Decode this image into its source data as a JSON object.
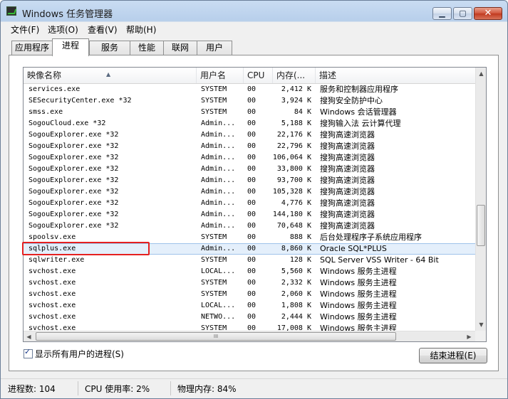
{
  "window": {
    "title": "Windows 任务管理器"
  },
  "titlebar_buttons": {
    "minimize": "▁",
    "maximize": "▢",
    "close": "✕"
  },
  "menu": [
    "文件(F)",
    "选项(O)",
    "查看(V)",
    "帮助(H)"
  ],
  "tabs": [
    {
      "label": "应用程序",
      "active": false
    },
    {
      "label": "进程",
      "active": true
    },
    {
      "label": "服务",
      "active": false
    },
    {
      "label": "性能",
      "active": false
    },
    {
      "label": "联网",
      "active": false
    },
    {
      "label": "用户",
      "active": false
    }
  ],
  "columns": {
    "name": "映像名称",
    "user": "用户名",
    "cpu": "CPU",
    "mem": "内存(...",
    "desc": "描述"
  },
  "processes": [
    {
      "name": "services.exe",
      "user": "SYSTEM",
      "cpu": "00",
      "mem": "2,412 K",
      "desc": "服务和控制器应用程序"
    },
    {
      "name": "SESecurityCenter.exe *32",
      "user": "SYSTEM",
      "cpu": "00",
      "mem": "3,924 K",
      "desc": "搜狗安全防护中心"
    },
    {
      "name": "smss.exe",
      "user": "SYSTEM",
      "cpu": "00",
      "mem": "84 K",
      "desc": "Windows 会话管理器"
    },
    {
      "name": "SogouCloud.exe *32",
      "user": "Admin...",
      "cpu": "00",
      "mem": "5,188 K",
      "desc": "搜狗输入法 云计算代理"
    },
    {
      "name": "SogouExplorer.exe *32",
      "user": "Admin...",
      "cpu": "00",
      "mem": "22,176 K",
      "desc": "搜狗高速浏览器"
    },
    {
      "name": "SogouExplorer.exe *32",
      "user": "Admin...",
      "cpu": "00",
      "mem": "22,796 K",
      "desc": "搜狗高速浏览器"
    },
    {
      "name": "SogouExplorer.exe *32",
      "user": "Admin...",
      "cpu": "00",
      "mem": "106,064 K",
      "desc": "搜狗高速浏览器"
    },
    {
      "name": "SogouExplorer.exe *32",
      "user": "Admin...",
      "cpu": "00",
      "mem": "33,800 K",
      "desc": "搜狗高速浏览器"
    },
    {
      "name": "SogouExplorer.exe *32",
      "user": "Admin...",
      "cpu": "00",
      "mem": "93,700 K",
      "desc": "搜狗高速浏览器"
    },
    {
      "name": "SogouExplorer.exe *32",
      "user": "Admin...",
      "cpu": "00",
      "mem": "105,328 K",
      "desc": "搜狗高速浏览器"
    },
    {
      "name": "SogouExplorer.exe *32",
      "user": "Admin...",
      "cpu": "00",
      "mem": "4,776 K",
      "desc": "搜狗高速浏览器"
    },
    {
      "name": "SogouExplorer.exe *32",
      "user": "Admin...",
      "cpu": "00",
      "mem": "144,180 K",
      "desc": "搜狗高速浏览器"
    },
    {
      "name": "SogouExplorer.exe *32",
      "user": "Admin...",
      "cpu": "00",
      "mem": "70,648 K",
      "desc": "搜狗高速浏览器"
    },
    {
      "name": "spoolsv.exe",
      "user": "SYSTEM",
      "cpu": "00",
      "mem": "888 K",
      "desc": "后台处理程序子系统应用程序"
    },
    {
      "name": "sqlplus.exe",
      "user": "Admin...",
      "cpu": "00",
      "mem": "8,860 K",
      "desc": "Oracle SQL*PLUS",
      "selected": true
    },
    {
      "name": "sqlwriter.exe",
      "user": "SYSTEM",
      "cpu": "00",
      "mem": "128 K",
      "desc": "SQL Server VSS Writer - 64 Bit"
    },
    {
      "name": "svchost.exe",
      "user": "LOCAL...",
      "cpu": "00",
      "mem": "5,560 K",
      "desc": "Windows 服务主进程"
    },
    {
      "name": "svchost.exe",
      "user": "SYSTEM",
      "cpu": "00",
      "mem": "2,332 K",
      "desc": "Windows 服务主进程"
    },
    {
      "name": "svchost.exe",
      "user": "SYSTEM",
      "cpu": "00",
      "mem": "2,060 K",
      "desc": "Windows 服务主进程"
    },
    {
      "name": "svchost.exe",
      "user": "LOCAL...",
      "cpu": "00",
      "mem": "1,808 K",
      "desc": "Windows 服务主进程"
    },
    {
      "name": "svchost.exe",
      "user": "NETWO...",
      "cpu": "00",
      "mem": "2,444 K",
      "desc": "Windows 服务主进程"
    },
    {
      "name": "svchost.exe",
      "user": "SYSTEM",
      "cpu": "00",
      "mem": "17,008 K",
      "desc": "Windows 服务主进程"
    }
  ],
  "scrollbar": {
    "up": "▲",
    "down": "▼",
    "left": "◀",
    "right": "▶",
    "grip": "III"
  },
  "show_all_users": {
    "label": "显示所有用户的进程(S)",
    "checked": true
  },
  "end_process_button": "结束进程(E)",
  "status": {
    "processes": "进程数: 104",
    "cpu": "CPU 使用率: 2%",
    "memory": "物理内存: 84%"
  },
  "colors": {
    "highlight_box": "#e52020",
    "selected_row": "#e4effb",
    "titlebar": "#b8cfeb"
  }
}
